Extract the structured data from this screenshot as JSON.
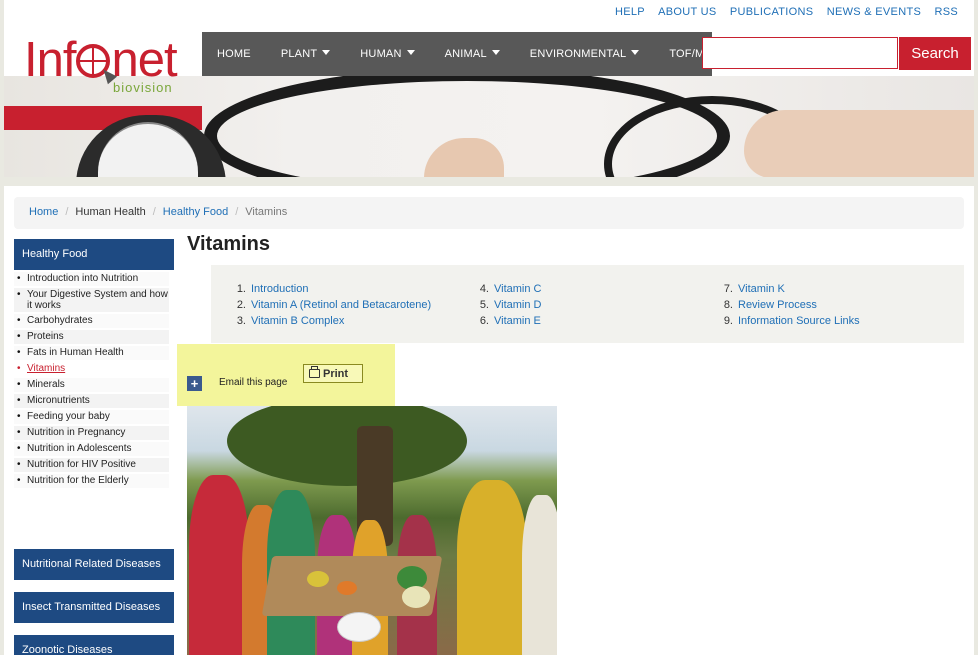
{
  "top_links": [
    "HELP",
    "ABOUT US",
    "PUBLICATIONS",
    "NEWS & EVENTS",
    "RSS"
  ],
  "logo": {
    "brand_left": "Inf",
    "brand_right": "net",
    "subtitle": "biovision"
  },
  "nav": {
    "items": [
      {
        "label": "HOME",
        "dropdown": false
      },
      {
        "label": "PLANT",
        "dropdown": true
      },
      {
        "label": "HUMAN",
        "dropdown": true
      },
      {
        "label": "ANIMAL",
        "dropdown": true
      },
      {
        "label": "ENVIRONMENTAL",
        "dropdown": true
      },
      {
        "label": "TOF/MKM",
        "dropdown": false
      }
    ]
  },
  "search": {
    "value": "",
    "placeholder": "",
    "button_label": "Search"
  },
  "breadcrumb": {
    "home": "Home",
    "section": "Human Health",
    "parent": "Healthy Food",
    "current": "Vitamins"
  },
  "sidebar": {
    "heading": "Healthy Food",
    "items": [
      "Introduction into Nutrition",
      "Your Digestive System and how it works",
      "Carbohydrates",
      "Proteins",
      "Fats in Human Health",
      "Vitamins",
      "Minerals",
      "Micronutrients",
      "Feeding your baby",
      "Nutrition in Pregnancy",
      "Nutrition in Adolescents",
      "Nutrition for HIV Positive",
      "Nutrition for the Elderly"
    ],
    "active_index": 5,
    "sections": [
      "Nutritional Related Diseases",
      "Insect Transmitted Diseases",
      "Zoonotic Diseases"
    ]
  },
  "main": {
    "title": "Vitamins",
    "toc": [
      [
        {
          "n": "1.",
          "label": "Introduction"
        },
        {
          "n": "2.",
          "label": "Vitamin A (Retinol and Betacarotene)"
        },
        {
          "n": "3.",
          "label": "Vitamin B Complex"
        }
      ],
      [
        {
          "n": "4.",
          "label": "Vitamin C"
        },
        {
          "n": "5.",
          "label": "Vitamin D"
        },
        {
          "n": "6.",
          "label": "Vitamin E"
        }
      ],
      [
        {
          "n": "7.",
          "label": "Vitamin K"
        },
        {
          "n": "8.",
          "label": "Review Process"
        },
        {
          "n": "9.",
          "label": "Information Source Links"
        }
      ]
    ],
    "tools": {
      "plus_label": "+",
      "email_label": "Email this page",
      "print_label": "Print"
    }
  },
  "colors": {
    "brand_red": "#c8202f",
    "nav_gray": "#585858",
    "sidebar_blue": "#1e4a82",
    "link_blue": "#1f6fb6",
    "tools_yellow": "#f3f59b"
  },
  "icons": [
    "globe-cursor-icon",
    "caret-down-icon",
    "plus-icon",
    "printer-icon"
  ]
}
